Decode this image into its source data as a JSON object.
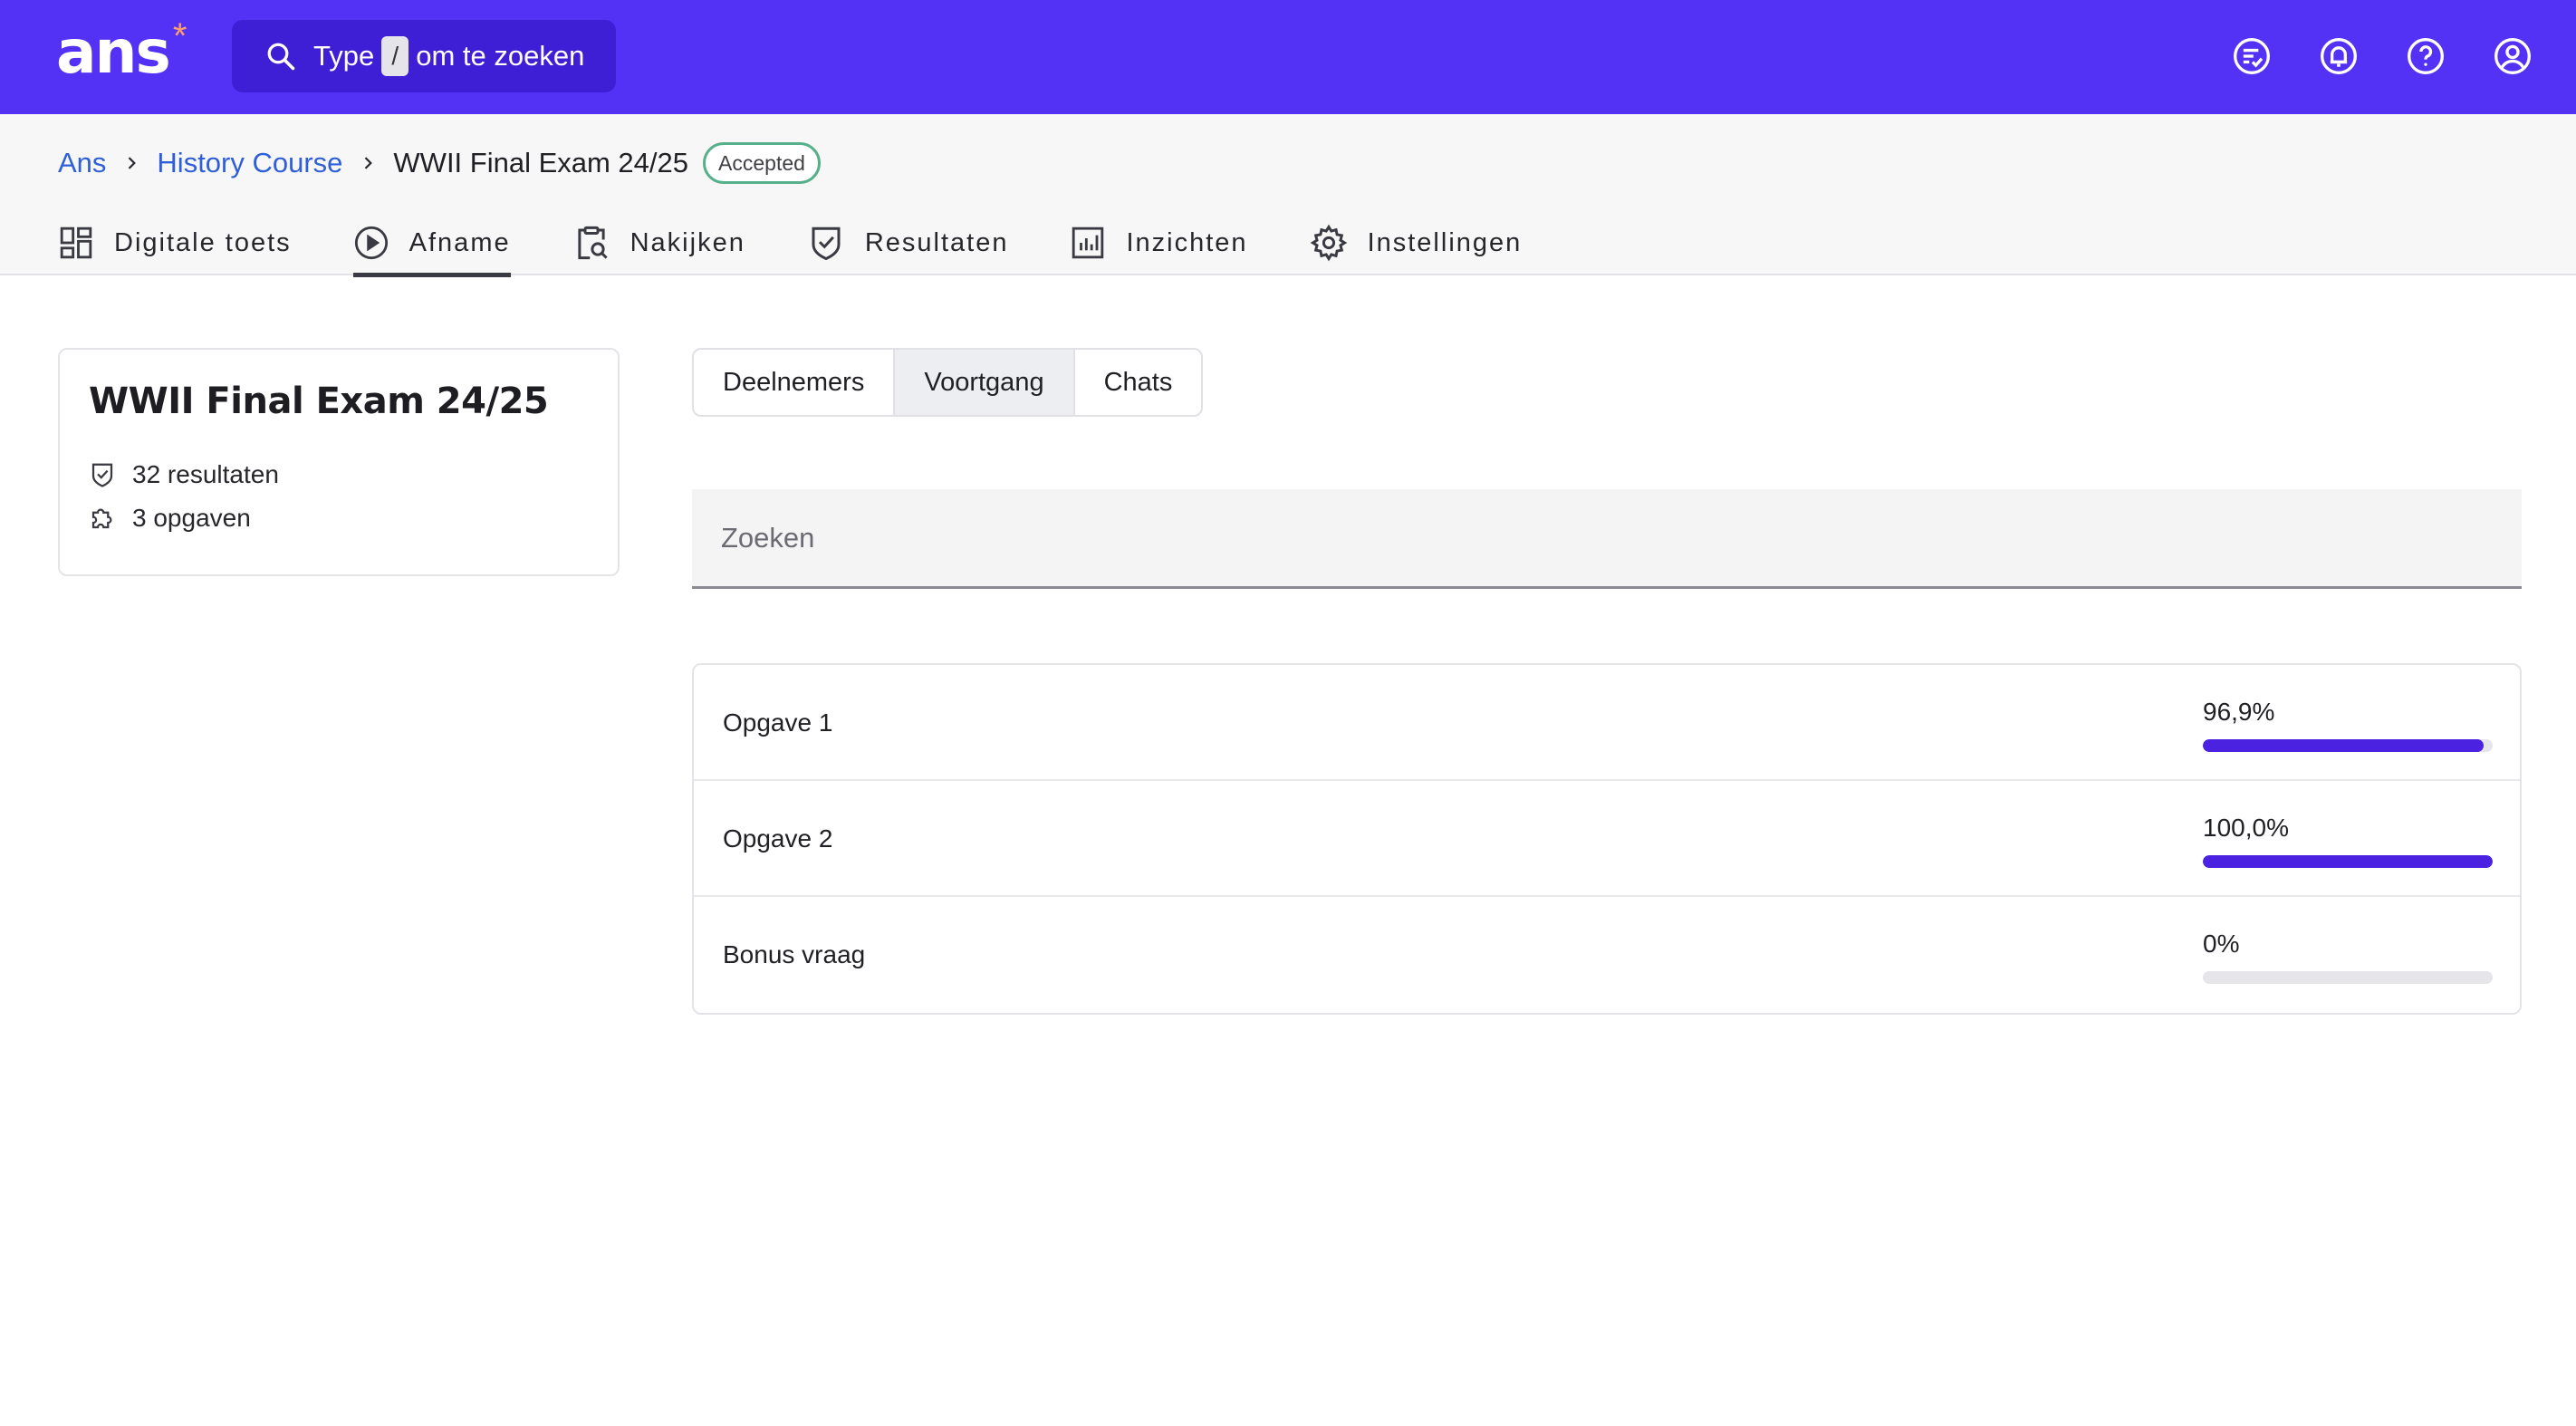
{
  "app": {
    "logo_text": "ans",
    "logo_mark": "*",
    "accent_color": "#5432f5"
  },
  "topbar": {
    "search": {
      "prefix": "Type",
      "key": "/",
      "suffix": "om te zoeken"
    },
    "icons": [
      "checklist-icon",
      "bell-icon",
      "help-icon",
      "user-icon"
    ]
  },
  "breadcrumb": {
    "items": [
      "Ans",
      "History Course"
    ],
    "current": "WWII Final Exam 24/25",
    "status_badge": "Accepted"
  },
  "tabs": [
    {
      "label": "Digitale toets",
      "icon": "dashboard-icon",
      "active": false
    },
    {
      "label": "Afname",
      "icon": "play-circle-icon",
      "active": true
    },
    {
      "label": "Nakijken",
      "icon": "clipboard-search-icon",
      "active": false
    },
    {
      "label": "Resultaten",
      "icon": "shield-check-icon",
      "active": false
    },
    {
      "label": "Inzichten",
      "icon": "bar-chart-icon",
      "active": false
    },
    {
      "label": "Instellingen",
      "icon": "gear-icon",
      "active": false
    }
  ],
  "info_card": {
    "title": "WWII Final Exam 24/25",
    "results": "32 resultaten",
    "questions": "3 opgaven"
  },
  "segmented": {
    "items": [
      "Deelnemers",
      "Voortgang",
      "Chats"
    ],
    "active_index": 1
  },
  "search_field": {
    "placeholder": "Zoeken",
    "value": ""
  },
  "progress": {
    "bar_color": "#4a22e0",
    "rows": [
      {
        "label": "Opgave 1",
        "percent_text": "96,9%",
        "fraction": 0.969
      },
      {
        "label": "Opgave 2",
        "percent_text": "100,0%",
        "fraction": 1.0
      },
      {
        "label": "Bonus vraag",
        "percent_text": "0%",
        "fraction": 0
      }
    ]
  }
}
